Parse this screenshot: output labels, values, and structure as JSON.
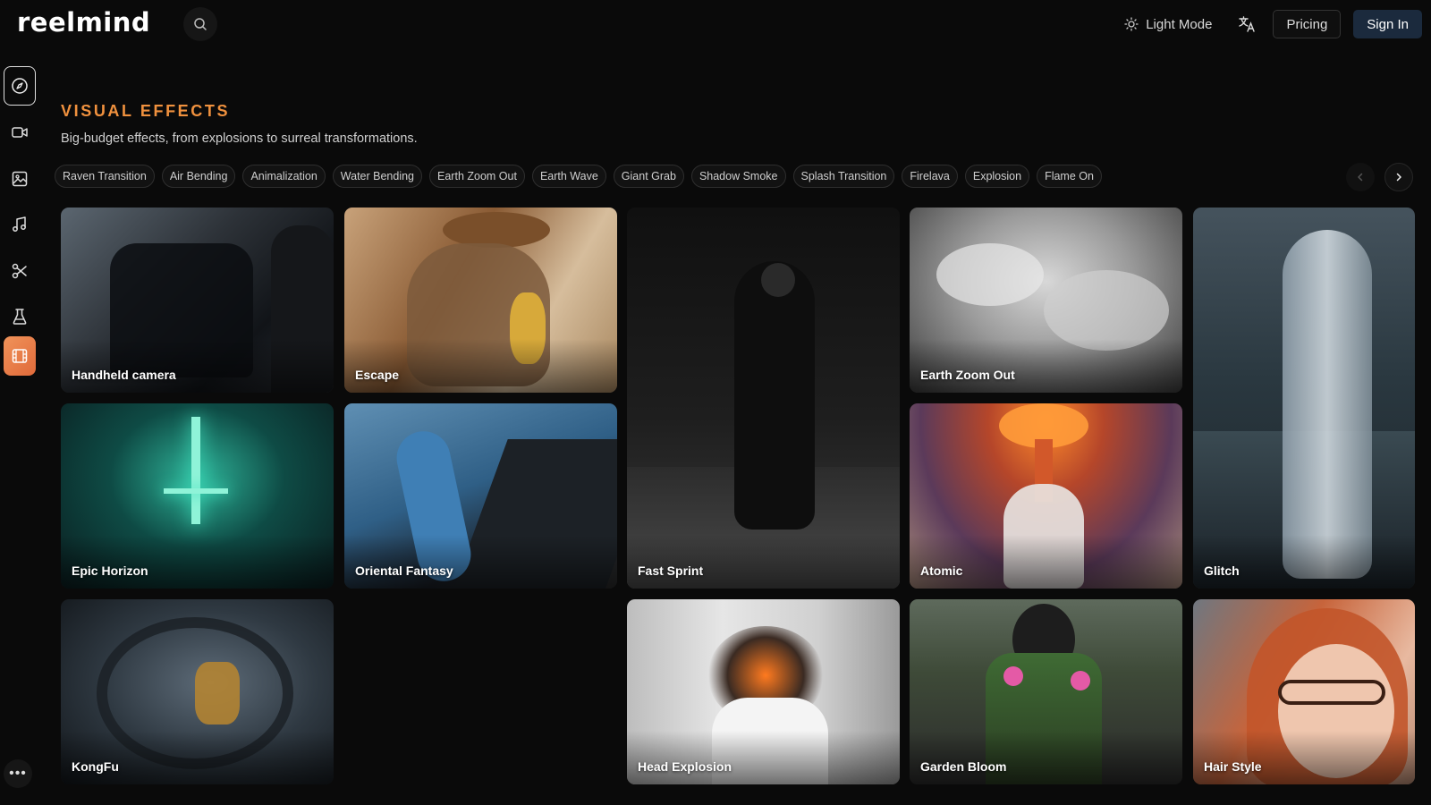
{
  "header": {
    "logo": "reelmind",
    "light_mode_label": "Light Mode",
    "pricing_label": "Pricing",
    "signin_label": "Sign In"
  },
  "sidebar": {
    "items": [
      {
        "icon": "compass-icon",
        "state": "active"
      },
      {
        "icon": "video-camera-icon"
      },
      {
        "icon": "image-icon"
      },
      {
        "icon": "music-note-icon"
      },
      {
        "icon": "scissors-icon"
      },
      {
        "icon": "flask-icon"
      },
      {
        "icon": "film-effects-icon",
        "state": "highlighted"
      }
    ],
    "more_label": "•••"
  },
  "section": {
    "title": "VISUAL EFFECTS",
    "subtitle": "Big-budget effects, from explosions to surreal transformations."
  },
  "chips": [
    "Raven Transition",
    "Air Bending",
    "Animalization",
    "Water Bending",
    "Earth Zoom Out",
    "Earth Wave",
    "Giant Grab",
    "Shadow Smoke",
    "Splash Transition",
    "Firelava",
    "Explosion",
    "Flame On"
  ],
  "cards": [
    {
      "label": "Handheld camera"
    },
    {
      "label": "Escape"
    },
    {
      "label": "Fast Sprint"
    },
    {
      "label": "Earth Zoom Out"
    },
    {
      "label": "Glitch"
    },
    {
      "label": "Epic Horizon"
    },
    {
      "label": "Oriental Fantasy"
    },
    {
      "label": "Atomic"
    },
    {
      "label": "KongFu"
    },
    {
      "label": "Head Explosion"
    },
    {
      "label": "Garden Bloom"
    },
    {
      "label": "Hair Style"
    }
  ],
  "colors": {
    "accent": "#f0913e",
    "signin_bg": "#1b2a3d",
    "highlight_bg": "#e06a3a"
  }
}
